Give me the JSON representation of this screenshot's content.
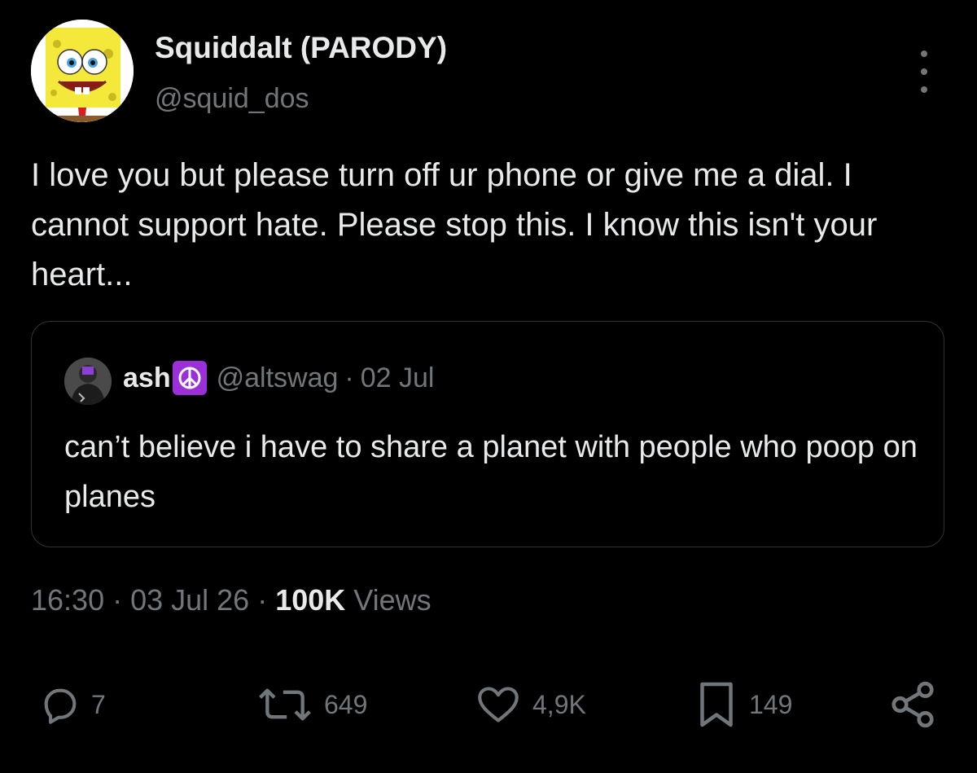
{
  "author": {
    "display_name": "Squiddalt (PARODY)",
    "handle": "@squid_dos"
  },
  "tweet": {
    "text": "I love you but please turn off ur phone or give me a dial. I cannot support hate. Please stop this. I know this isn't your heart..."
  },
  "quoted_tweet": {
    "name": "ash",
    "badge_icon": "peace-symbol-icon",
    "handle": "@altswag",
    "separator": "·",
    "date": "02 Jul",
    "text": "can’t believe i have to share a planet with people who poop on planes"
  },
  "meta": {
    "time": "16:30",
    "separator": "·",
    "date": "03 Jul 26",
    "views_count": "100K",
    "views_label": "Views"
  },
  "actions": {
    "reply_count": "7",
    "repost_count": "649",
    "like_count": "4,9K",
    "bookmark_count": "149"
  },
  "colors": {
    "background": "#000000",
    "text": "#e7e9ea",
    "muted": "#71767b",
    "border": "#2f3336",
    "peace_badge": "#9b30d9"
  }
}
